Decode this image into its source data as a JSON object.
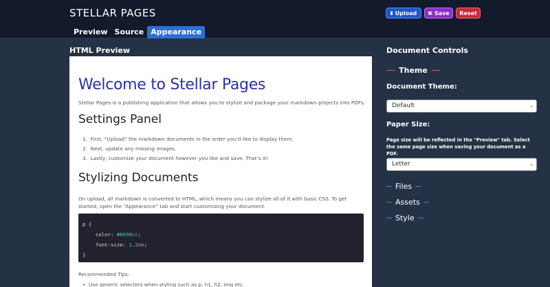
{
  "header": {
    "brand": "STELLAR PAGES",
    "tabs": [
      "Preview",
      "Source",
      "Appearance"
    ],
    "active_tab": "Appearance",
    "buttons": {
      "upload": "Upload",
      "save": "Save",
      "reset": "Reset"
    }
  },
  "preview": {
    "section_title": "HTML Preview",
    "h1": "Welcome to Stellar Pages",
    "intro": "Stellar Pages is a publishing application that allows you to stylize and package your markdown projects into PDFs.",
    "settings_heading": "Settings Panel",
    "steps": [
      "First, “Upload” the markdown documents in the order you’d like to display them.",
      "Next, update any missing images.",
      "Lastly, customize your document however you like and save. That’s it!"
    ],
    "stylizing_heading": "Stylizing Documents",
    "stylizing_p1": "On upload, all markdown is converted to HTML, which means you can stylize all of it with basic CSS. To get",
    "stylizing_p2": "started, open the “Appearance” tab and start customizing your document.",
    "code": {
      "line1": "p {",
      "color_prop": "color: ",
      "color_val": "#0099cc",
      "size_prop": "font-size: ",
      "size_num": "1.2",
      "size_unit": "em",
      "close": "}"
    },
    "tips_label": "Recommended Tips:",
    "tip1": "Use generic selectors when styling such as p, h1, h2, img etc."
  },
  "controls": {
    "section_title": "Document Controls",
    "theme_heading": "Theme",
    "document_theme_label": "Document Theme:",
    "document_theme_value": "Default",
    "paper_size_label": "Paper Size:",
    "paper_size_hint": "Page size will be reflected in the \"Preview\" tab. Select the same page size when saving your document as a PDF.",
    "paper_size_value": "Letter",
    "accordions": [
      "Files",
      "Assets",
      "Style"
    ]
  },
  "colors": {
    "background": "#253245",
    "header": "#121a2b",
    "tab_active": "#2d6fd3",
    "upload": "#2056c9",
    "save": "#8a2fc4",
    "reset": "#c8273b",
    "preview_heading": "#2b2faa",
    "theme_dash": "#e0505e",
    "accordion_dash": "#4a7ce0"
  }
}
